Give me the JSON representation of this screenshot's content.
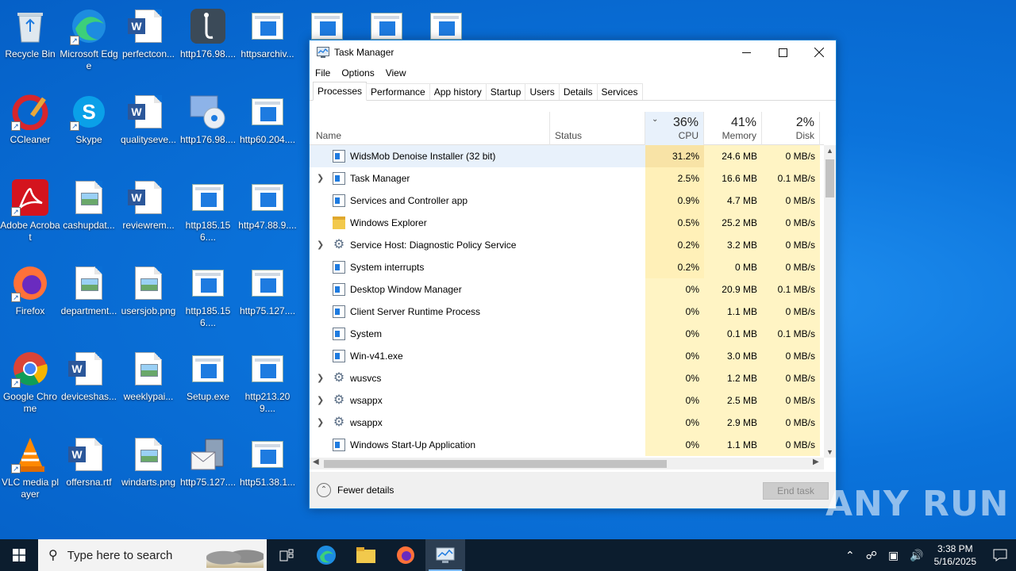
{
  "desktop": {
    "icons": [
      {
        "label": "Recycle Bin",
        "kind": "recycle"
      },
      {
        "label": "Microsoft Edge",
        "kind": "edge"
      },
      {
        "label": "perfectcon...",
        "kind": "word"
      },
      {
        "label": "http176.98....",
        "kind": "tool"
      },
      {
        "label": "httpsarchiv...",
        "kind": "winfile"
      },
      {
        "label": "ht",
        "kind": "winfile"
      },
      {
        "label": "",
        "kind": "winfile"
      },
      {
        "label": "",
        "kind": "winfile"
      },
      {
        "label": "CCleaner",
        "kind": "ccleaner"
      },
      {
        "label": "Skype",
        "kind": "skype"
      },
      {
        "label": "qualityseve...",
        "kind": "word"
      },
      {
        "label": "http176.98....",
        "kind": "disc"
      },
      {
        "label": "http60.204....",
        "kind": "winfile"
      },
      {
        "label": "ht",
        "kind": "winfile"
      },
      {
        "label": "Adobe Acrobat",
        "kind": "acrobat"
      },
      {
        "label": "cashupdat...",
        "kind": "image"
      },
      {
        "label": "reviewrem...",
        "kind": "word"
      },
      {
        "label": "http185.156....",
        "kind": "winfile"
      },
      {
        "label": "http47.88.9....",
        "kind": "winfile"
      },
      {
        "label": "ht",
        "kind": "winfile"
      },
      {
        "label": "Firefox",
        "kind": "firefox"
      },
      {
        "label": "department...",
        "kind": "image"
      },
      {
        "label": "usersjob.png",
        "kind": "image"
      },
      {
        "label": "http185.156....",
        "kind": "winfile"
      },
      {
        "label": "http75.127....",
        "kind": "winfile"
      },
      {
        "label": "ht",
        "kind": "winfile"
      },
      {
        "label": "Google Chrome",
        "kind": "chrome"
      },
      {
        "label": "deviceshas...",
        "kind": "word"
      },
      {
        "label": "weeklypai...",
        "kind": "image"
      },
      {
        "label": "Setup.exe",
        "kind": "winfile"
      },
      {
        "label": "http213.209....",
        "kind": "winfile"
      },
      {
        "label": "ht",
        "kind": "winfile"
      },
      {
        "label": "VLC media player",
        "kind": "vlc"
      },
      {
        "label": "offersna.rtf",
        "kind": "word"
      },
      {
        "label": "windarts.png",
        "kind": "image"
      },
      {
        "label": "http75.127....",
        "kind": "mail"
      },
      {
        "label": "http51.38.1...",
        "kind": "winfile"
      },
      {
        "label": "ht",
        "kind": "winfile"
      }
    ]
  },
  "taskmanager": {
    "title": "Task Manager",
    "menu": [
      "File",
      "Options",
      "View"
    ],
    "tabs": [
      "Processes",
      "Performance",
      "App history",
      "Startup",
      "Users",
      "Details",
      "Services"
    ],
    "active_tab": "Processes",
    "columns": {
      "name": "Name",
      "status": "Status",
      "cpu_pct": "36%",
      "cpu": "CPU",
      "mem_pct": "41%",
      "mem": "Memory",
      "disk_pct": "2%",
      "disk": "Disk"
    },
    "processes": [
      {
        "name": "WidsMob Denoise Installer (32 bit)",
        "expandable": false,
        "icon": "installer-icon",
        "cpu": "31.2%",
        "mem": "24.6 MB",
        "disk": "0 MB/s"
      },
      {
        "name": "Task Manager",
        "expandable": true,
        "icon": "taskmgr-icon",
        "cpu": "2.5%",
        "mem": "16.6 MB",
        "disk": "0.1 MB/s"
      },
      {
        "name": "Services and Controller app",
        "expandable": false,
        "icon": "sysbox-icon",
        "cpu": "0.9%",
        "mem": "4.7 MB",
        "disk": "0 MB/s"
      },
      {
        "name": "Windows Explorer",
        "expandable": false,
        "icon": "folder-icon",
        "cpu": "0.5%",
        "mem": "25.2 MB",
        "disk": "0 MB/s"
      },
      {
        "name": "Service Host: Diagnostic Policy Service",
        "expandable": true,
        "icon": "gear-icon",
        "cpu": "0.2%",
        "mem": "3.2 MB",
        "disk": "0 MB/s"
      },
      {
        "name": "System interrupts",
        "expandable": false,
        "icon": "sysbox-icon",
        "cpu": "0.2%",
        "mem": "0 MB",
        "disk": "0 MB/s"
      },
      {
        "name": "Desktop Window Manager",
        "expandable": false,
        "icon": "sysbox-icon",
        "cpu": "0%",
        "mem": "20.9 MB",
        "disk": "0.1 MB/s"
      },
      {
        "name": "Client Server Runtime Process",
        "expandable": false,
        "icon": "sysbox-icon",
        "cpu": "0%",
        "mem": "1.1 MB",
        "disk": "0 MB/s"
      },
      {
        "name": "System",
        "expandable": false,
        "icon": "sysbox-icon",
        "cpu": "0%",
        "mem": "0.1 MB",
        "disk": "0.1 MB/s"
      },
      {
        "name": "Win-v41.exe",
        "expandable": false,
        "icon": "sysbox-icon",
        "cpu": "0%",
        "mem": "3.0 MB",
        "disk": "0 MB/s"
      },
      {
        "name": "wusvcs",
        "expandable": true,
        "icon": "gear-icon",
        "cpu": "0%",
        "mem": "1.2 MB",
        "disk": "0 MB/s"
      },
      {
        "name": "wsappx",
        "expandable": true,
        "icon": "gear-icon",
        "cpu": "0%",
        "mem": "2.5 MB",
        "disk": "0 MB/s"
      },
      {
        "name": "wsappx",
        "expandable": true,
        "icon": "gear-icon",
        "cpu": "0%",
        "mem": "2.9 MB",
        "disk": "0 MB/s"
      },
      {
        "name": "Windows Start-Up Application",
        "expandable": false,
        "icon": "sysbox-icon",
        "cpu": "0%",
        "mem": "1.1 MB",
        "disk": "0 MB/s"
      }
    ],
    "fewer_details": "Fewer details",
    "end_task": "End task"
  },
  "watermark": "ANY RUN",
  "taskbar": {
    "search_placeholder": "Type here to search",
    "time": "3:38 PM",
    "date": "5/16/2025"
  }
}
